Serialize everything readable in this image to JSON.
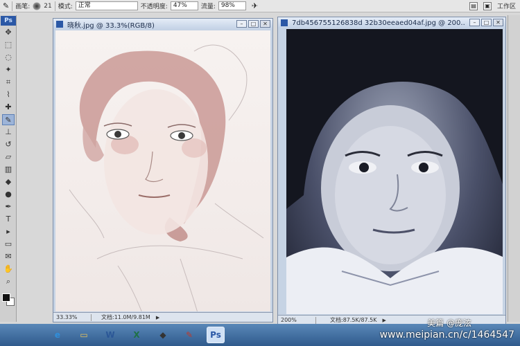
{
  "options_bar": {
    "brush_label": "画笔:",
    "brush_size": "21",
    "mode_label": "模式:",
    "mode_value": "正常",
    "opacity_label": "不透明度:",
    "opacity_value": "47%",
    "flow_label": "流量:",
    "flow_value": "98%",
    "workspace_label": "工作区"
  },
  "tools": {
    "app_badge": "Ps",
    "items": [
      "move",
      "marquee",
      "lasso",
      "magic-wand",
      "crop",
      "eyedropper",
      "healing",
      "brush",
      "stamp",
      "history-brush",
      "eraser",
      "gradient",
      "blur",
      "dodge",
      "pen",
      "type",
      "path-select",
      "shape",
      "notes",
      "eyedropper-2",
      "hand",
      "zoom"
    ],
    "selected": "brush"
  },
  "left_doc": {
    "title": "晓秋.jpg @ 33.3%(RGB/8)",
    "zoom": "33.33%",
    "doc_size": "文档:11.0M/9.81M"
  },
  "right_doc": {
    "title": "7db456755126838d 32b30eeaed04af.jpg @ 200...",
    "zoom": "200%",
    "doc_size": "文档:87.5K/87.5K"
  },
  "taskbar": {
    "apps": [
      {
        "name": "ie",
        "glyph": "e",
        "color": "#2f8fdc"
      },
      {
        "name": "explorer",
        "glyph": "▭",
        "color": "#e8c35a"
      },
      {
        "name": "word",
        "glyph": "W",
        "color": "#2b5797"
      },
      {
        "name": "excel",
        "glyph": "X",
        "color": "#1e7145"
      },
      {
        "name": "app-4",
        "glyph": "◆",
        "color": "#333333"
      },
      {
        "name": "paint",
        "glyph": "✎",
        "color": "#c0392b"
      },
      {
        "name": "photoshop",
        "glyph": "Ps",
        "color": "#2b58a6"
      }
    ],
    "active": "photoshop"
  },
  "watermark": {
    "brand": "美篇 @庞泫",
    "url": "www.meipian.cn/c/1464547"
  }
}
